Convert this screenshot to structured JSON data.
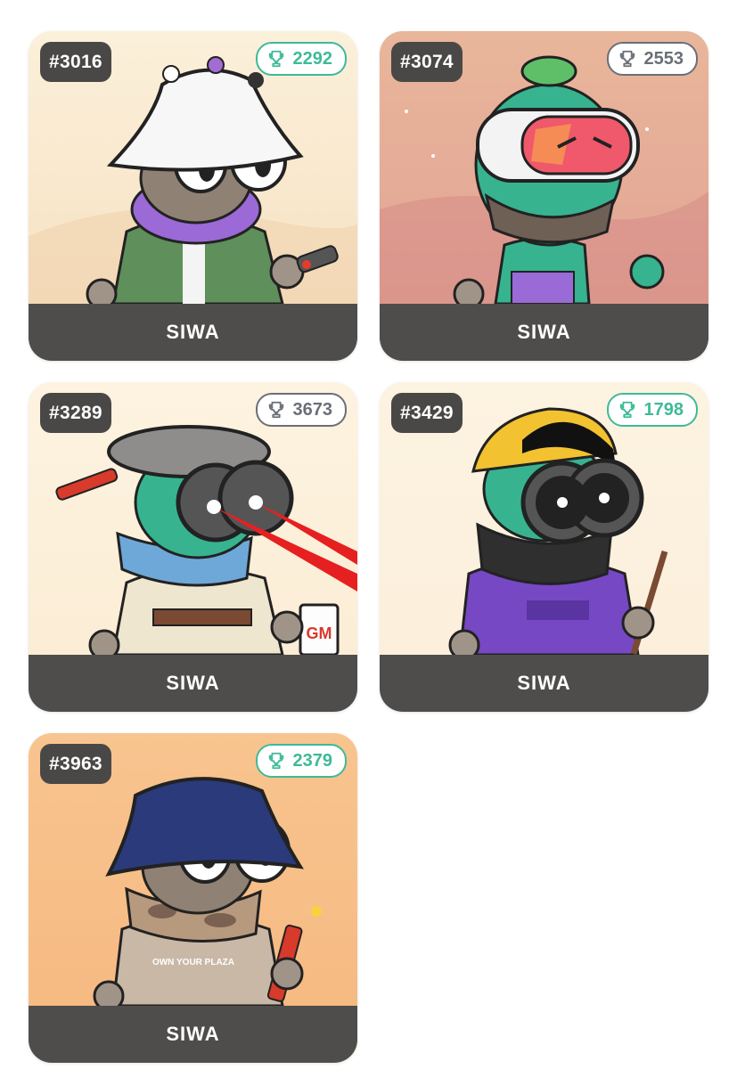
{
  "cards": [
    {
      "id": "#3016",
      "score": "2292",
      "name": "SIWA",
      "trophy_color": "#3fba98"
    },
    {
      "id": "#3074",
      "score": "2553",
      "name": "SIWA",
      "trophy_color": "#6a6f77"
    },
    {
      "id": "#3289",
      "score": "3673",
      "name": "SIWA",
      "trophy_color": "#6a6f77"
    },
    {
      "id": "#3429",
      "score": "1798",
      "name": "SIWA",
      "trophy_color": "#3fba98"
    },
    {
      "id": "#3963",
      "score": "2379",
      "name": "SIWA",
      "trophy_color": "#3fba98"
    }
  ],
  "art_labels": {
    "mug_text": "GM",
    "hoodie_text": "OWN YOUR PLAZA"
  },
  "icons": {
    "trophy": "trophy-icon"
  }
}
